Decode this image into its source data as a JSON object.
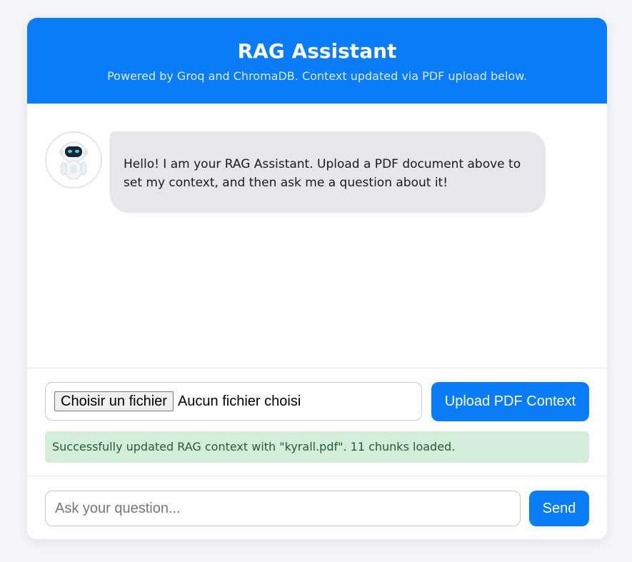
{
  "header": {
    "title": "RAG Assistant",
    "subtitle": "Powered by Groq and ChromaDB. Context updated via PDF upload below."
  },
  "chat": {
    "messages": [
      {
        "role": "assistant",
        "avatar": "robot-icon",
        "text": "Hello! I am your RAG Assistant. Upload a PDF document above to set my context, and then ask me a question about it!"
      }
    ]
  },
  "upload": {
    "file_button_label": "Choisir un fichier",
    "file_status": "Aucun fichier choisi",
    "upload_button_label": "Upload PDF Context",
    "status_message": "Successfully updated RAG context with \"kyrall.pdf\". 11 chunks loaded."
  },
  "question": {
    "placeholder": "Ask your question...",
    "value": "",
    "send_label": "Send"
  },
  "colors": {
    "accent": "#0a7cf7",
    "bubble_bg": "#e6e6eb",
    "success_bg": "#d4edda",
    "success_text": "#1f5f2f",
    "page_bg": "#f4f5f9"
  }
}
